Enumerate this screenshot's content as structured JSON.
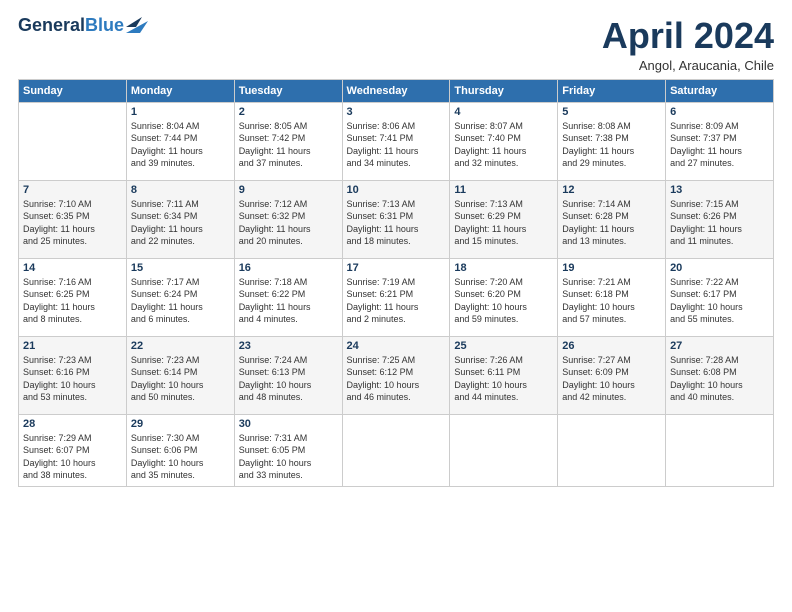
{
  "logo": {
    "line1": "General",
    "line2": "Blue"
  },
  "header": {
    "month": "April 2024",
    "location": "Angol, Araucania, Chile"
  },
  "days_of_week": [
    "Sunday",
    "Monday",
    "Tuesday",
    "Wednesday",
    "Thursday",
    "Friday",
    "Saturday"
  ],
  "weeks": [
    [
      {
        "day": "",
        "info": ""
      },
      {
        "day": "1",
        "info": "Sunrise: 8:04 AM\nSunset: 7:44 PM\nDaylight: 11 hours\nand 39 minutes."
      },
      {
        "day": "2",
        "info": "Sunrise: 8:05 AM\nSunset: 7:42 PM\nDaylight: 11 hours\nand 37 minutes."
      },
      {
        "day": "3",
        "info": "Sunrise: 8:06 AM\nSunset: 7:41 PM\nDaylight: 11 hours\nand 34 minutes."
      },
      {
        "day": "4",
        "info": "Sunrise: 8:07 AM\nSunset: 7:40 PM\nDaylight: 11 hours\nand 32 minutes."
      },
      {
        "day": "5",
        "info": "Sunrise: 8:08 AM\nSunset: 7:38 PM\nDaylight: 11 hours\nand 29 minutes."
      },
      {
        "day": "6",
        "info": "Sunrise: 8:09 AM\nSunset: 7:37 PM\nDaylight: 11 hours\nand 27 minutes."
      }
    ],
    [
      {
        "day": "7",
        "info": "Sunrise: 7:10 AM\nSunset: 6:35 PM\nDaylight: 11 hours\nand 25 minutes."
      },
      {
        "day": "8",
        "info": "Sunrise: 7:11 AM\nSunset: 6:34 PM\nDaylight: 11 hours\nand 22 minutes."
      },
      {
        "day": "9",
        "info": "Sunrise: 7:12 AM\nSunset: 6:32 PM\nDaylight: 11 hours\nand 20 minutes."
      },
      {
        "day": "10",
        "info": "Sunrise: 7:13 AM\nSunset: 6:31 PM\nDaylight: 11 hours\nand 18 minutes."
      },
      {
        "day": "11",
        "info": "Sunrise: 7:13 AM\nSunset: 6:29 PM\nDaylight: 11 hours\nand 15 minutes."
      },
      {
        "day": "12",
        "info": "Sunrise: 7:14 AM\nSunset: 6:28 PM\nDaylight: 11 hours\nand 13 minutes."
      },
      {
        "day": "13",
        "info": "Sunrise: 7:15 AM\nSunset: 6:26 PM\nDaylight: 11 hours\nand 11 minutes."
      }
    ],
    [
      {
        "day": "14",
        "info": "Sunrise: 7:16 AM\nSunset: 6:25 PM\nDaylight: 11 hours\nand 8 minutes."
      },
      {
        "day": "15",
        "info": "Sunrise: 7:17 AM\nSunset: 6:24 PM\nDaylight: 11 hours\nand 6 minutes."
      },
      {
        "day": "16",
        "info": "Sunrise: 7:18 AM\nSunset: 6:22 PM\nDaylight: 11 hours\nand 4 minutes."
      },
      {
        "day": "17",
        "info": "Sunrise: 7:19 AM\nSunset: 6:21 PM\nDaylight: 11 hours\nand 2 minutes."
      },
      {
        "day": "18",
        "info": "Sunrise: 7:20 AM\nSunset: 6:20 PM\nDaylight: 10 hours\nand 59 minutes."
      },
      {
        "day": "19",
        "info": "Sunrise: 7:21 AM\nSunset: 6:18 PM\nDaylight: 10 hours\nand 57 minutes."
      },
      {
        "day": "20",
        "info": "Sunrise: 7:22 AM\nSunset: 6:17 PM\nDaylight: 10 hours\nand 55 minutes."
      }
    ],
    [
      {
        "day": "21",
        "info": "Sunrise: 7:23 AM\nSunset: 6:16 PM\nDaylight: 10 hours\nand 53 minutes."
      },
      {
        "day": "22",
        "info": "Sunrise: 7:23 AM\nSunset: 6:14 PM\nDaylight: 10 hours\nand 50 minutes."
      },
      {
        "day": "23",
        "info": "Sunrise: 7:24 AM\nSunset: 6:13 PM\nDaylight: 10 hours\nand 48 minutes."
      },
      {
        "day": "24",
        "info": "Sunrise: 7:25 AM\nSunset: 6:12 PM\nDaylight: 10 hours\nand 46 minutes."
      },
      {
        "day": "25",
        "info": "Sunrise: 7:26 AM\nSunset: 6:11 PM\nDaylight: 10 hours\nand 44 minutes."
      },
      {
        "day": "26",
        "info": "Sunrise: 7:27 AM\nSunset: 6:09 PM\nDaylight: 10 hours\nand 42 minutes."
      },
      {
        "day": "27",
        "info": "Sunrise: 7:28 AM\nSunset: 6:08 PM\nDaylight: 10 hours\nand 40 minutes."
      }
    ],
    [
      {
        "day": "28",
        "info": "Sunrise: 7:29 AM\nSunset: 6:07 PM\nDaylight: 10 hours\nand 38 minutes."
      },
      {
        "day": "29",
        "info": "Sunrise: 7:30 AM\nSunset: 6:06 PM\nDaylight: 10 hours\nand 35 minutes."
      },
      {
        "day": "30",
        "info": "Sunrise: 7:31 AM\nSunset: 6:05 PM\nDaylight: 10 hours\nand 33 minutes."
      },
      {
        "day": "",
        "info": ""
      },
      {
        "day": "",
        "info": ""
      },
      {
        "day": "",
        "info": ""
      },
      {
        "day": "",
        "info": ""
      }
    ]
  ]
}
